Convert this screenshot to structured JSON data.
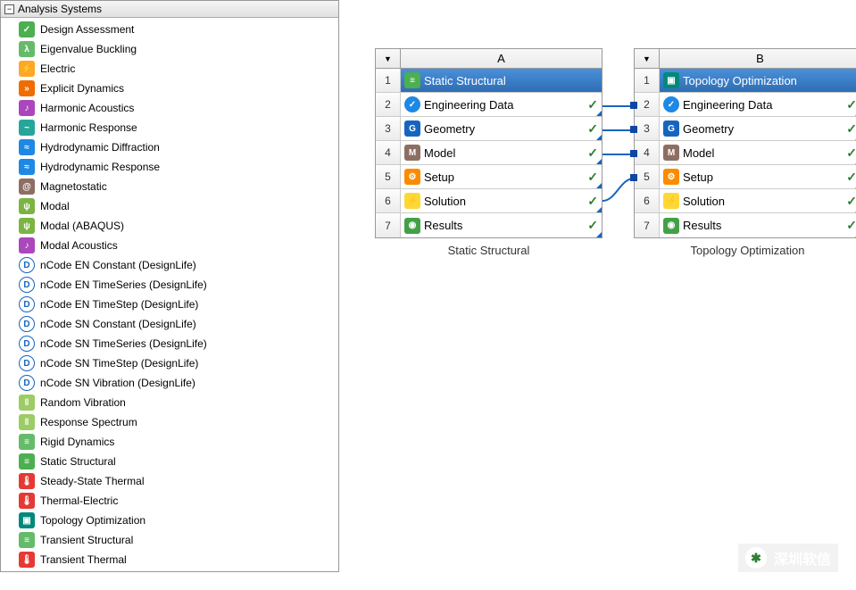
{
  "toolbox": {
    "header": "Analysis Systems",
    "items": [
      {
        "label": "Design Assessment",
        "icon": "ic-check",
        "glyph": "✓"
      },
      {
        "label": "Eigenvalue Buckling",
        "icon": "ic-buckling",
        "glyph": "λ"
      },
      {
        "label": "Electric",
        "icon": "ic-electric",
        "glyph": "⚡"
      },
      {
        "label": "Explicit Dynamics",
        "icon": "ic-explicit",
        "glyph": "»"
      },
      {
        "label": "Harmonic Acoustics",
        "icon": "ic-harmonic-ac",
        "glyph": "♪"
      },
      {
        "label": "Harmonic Response",
        "icon": "ic-harmonic-resp",
        "glyph": "~"
      },
      {
        "label": "Hydrodynamic Diffraction",
        "icon": "ic-hydro",
        "glyph": "≈"
      },
      {
        "label": "Hydrodynamic Response",
        "icon": "ic-hydro",
        "glyph": "≈"
      },
      {
        "label": "Magnetostatic",
        "icon": "ic-magneto",
        "glyph": "@"
      },
      {
        "label": "Modal",
        "icon": "ic-modal",
        "glyph": "ψ"
      },
      {
        "label": "Modal (ABAQUS)",
        "icon": "ic-modal",
        "glyph": "ψ"
      },
      {
        "label": "Modal Acoustics",
        "icon": "ic-modal-ac",
        "glyph": "♪"
      },
      {
        "label": "nCode EN Constant (DesignLife)",
        "icon": "ic-ncode",
        "glyph": "D"
      },
      {
        "label": "nCode EN TimeSeries (DesignLife)",
        "icon": "ic-ncode",
        "glyph": "D"
      },
      {
        "label": "nCode EN TimeStep (DesignLife)",
        "icon": "ic-ncode",
        "glyph": "D"
      },
      {
        "label": "nCode SN Constant (DesignLife)",
        "icon": "ic-ncode",
        "glyph": "D"
      },
      {
        "label": "nCode SN TimeSeries (DesignLife)",
        "icon": "ic-ncode",
        "glyph": "D"
      },
      {
        "label": "nCode SN TimeStep (DesignLife)",
        "icon": "ic-ncode",
        "glyph": "D"
      },
      {
        "label": "nCode SN Vibration (DesignLife)",
        "icon": "ic-ncode",
        "glyph": "D"
      },
      {
        "label": "Random Vibration",
        "icon": "ic-random",
        "glyph": "‖"
      },
      {
        "label": "Response Spectrum",
        "icon": "ic-response",
        "glyph": "‖"
      },
      {
        "label": "Rigid Dynamics",
        "icon": "ic-rigid",
        "glyph": "≡"
      },
      {
        "label": "Static Structural",
        "icon": "ic-static",
        "glyph": "≡"
      },
      {
        "label": "Steady-State Thermal",
        "icon": "ic-thermal",
        "glyph": "🌡"
      },
      {
        "label": "Thermal-Electric",
        "icon": "ic-thermal-elec",
        "glyph": "🌡"
      },
      {
        "label": "Topology Optimization",
        "icon": "ic-topology",
        "glyph": "▣"
      },
      {
        "label": "Transient Structural",
        "icon": "ic-trans-struct",
        "glyph": "≡"
      },
      {
        "label": "Transient Thermal",
        "icon": "ic-trans-thermal",
        "glyph": "🌡"
      }
    ]
  },
  "systems": {
    "a": {
      "column": "A",
      "title": "Static Structural",
      "header": {
        "label": "Static Structural",
        "icon": "ic-static",
        "glyph": "≡"
      },
      "cells": [
        {
          "num": "2",
          "label": "Engineering Data",
          "icon": "ic-engdata",
          "glyph": "✓",
          "status": "✓"
        },
        {
          "num": "3",
          "label": "Geometry",
          "icon": "ic-geom",
          "glyph": "G",
          "status": "✓"
        },
        {
          "num": "4",
          "label": "Model",
          "icon": "ic-model",
          "glyph": "M",
          "status": "✓"
        },
        {
          "num": "5",
          "label": "Setup",
          "icon": "ic-setup",
          "glyph": "⚙",
          "status": "✓"
        },
        {
          "num": "6",
          "label": "Solution",
          "icon": "ic-solution",
          "glyph": "⚡",
          "status": "✓"
        },
        {
          "num": "7",
          "label": "Results",
          "icon": "ic-results",
          "glyph": "◉",
          "status": "✓"
        }
      ]
    },
    "b": {
      "column": "B",
      "title": "Topology Optimization",
      "header": {
        "label": "Topology Optimization",
        "icon": "ic-topology",
        "glyph": "▣"
      },
      "cells": [
        {
          "num": "2",
          "label": "Engineering Data",
          "icon": "ic-engdata",
          "glyph": "✓",
          "status": "✓"
        },
        {
          "num": "3",
          "label": "Geometry",
          "icon": "ic-geom",
          "glyph": "G",
          "status": "✓"
        },
        {
          "num": "4",
          "label": "Model",
          "icon": "ic-model",
          "glyph": "M",
          "status": "✓"
        },
        {
          "num": "5",
          "label": "Setup",
          "icon": "ic-setup",
          "glyph": "⚙",
          "status": "✓"
        },
        {
          "num": "6",
          "label": "Solution",
          "icon": "ic-solution",
          "glyph": "⚡",
          "status": "✓"
        },
        {
          "num": "7",
          "label": "Results",
          "icon": "ic-results",
          "glyph": "◉",
          "status": "✓"
        }
      ]
    }
  },
  "watermark": "深圳软信"
}
